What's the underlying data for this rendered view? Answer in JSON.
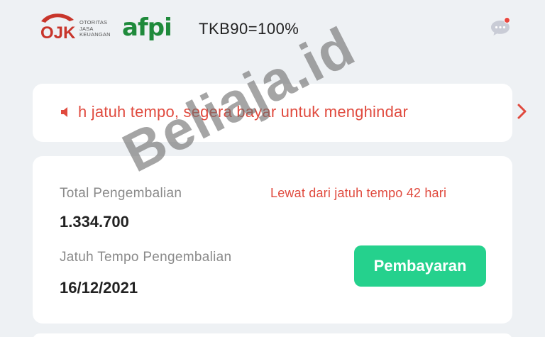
{
  "header": {
    "ojk_text": [
      "OTORITAS",
      "JASA",
      "KEUANGAN"
    ],
    "ojk_mark": "OJK",
    "afpi_label": "afpi",
    "tkb_text": "TKB90=100%",
    "chat_icon": "chat-bubble-icon"
  },
  "notice": {
    "icon": "speaker-icon",
    "message": "h jatuh tempo, segera bayar untuk menghindar",
    "chevron": "chevron-right-icon"
  },
  "loan": {
    "total_label": "Total Pengembalian",
    "total_value": "1.334.700",
    "due_label": "Jatuh Tempo Pengembalian",
    "due_value": "16/12/2021",
    "overdue_text": "Lewat dari jatuh tempo 42 hari",
    "pay_button": "Pembayaran"
  },
  "watermark": "Beliaja.id",
  "colors": {
    "background": "#eef1f4",
    "accent_red": "#e04a3e",
    "pay_green": "#25d18d",
    "afpi_green": "#1f8a3b"
  }
}
